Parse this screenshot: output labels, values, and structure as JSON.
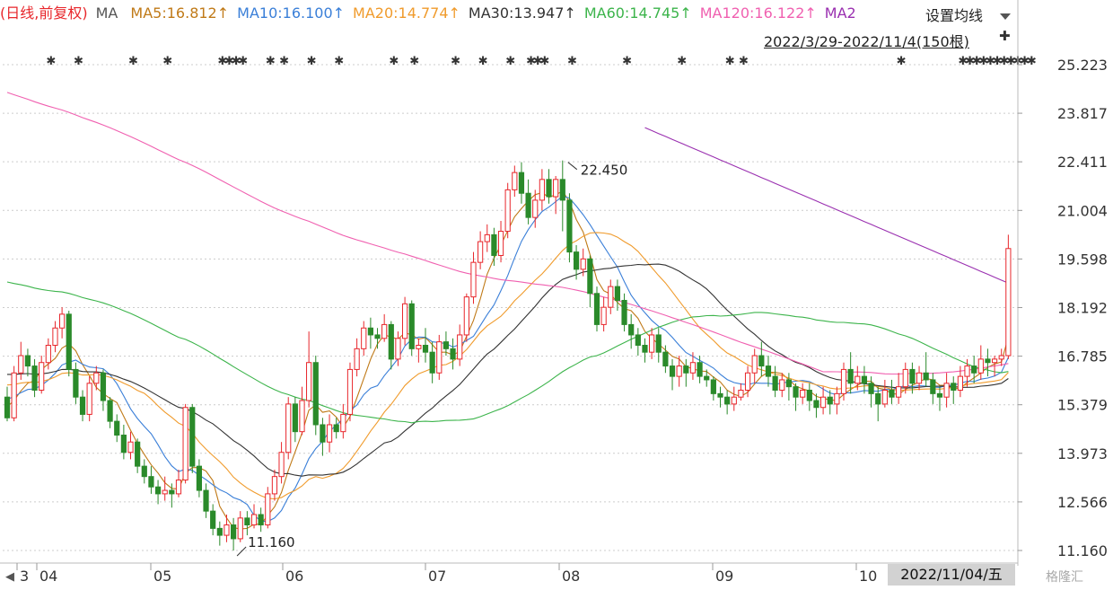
{
  "legend": {
    "prefix": "(日线,前复权)",
    "ma_label": "MA",
    "items": [
      {
        "text": "MA5:16.812↑",
        "color": "#c07a18"
      },
      {
        "text": "MA10:16.100↑",
        "color": "#3a7fd8"
      },
      {
        "text": "MA20:14.774↑",
        "color": "#f09b2c"
      },
      {
        "text": "MA30:13.947↑",
        "color": "#333333"
      },
      {
        "text": "MA60:14.745↑",
        "color": "#3cb44b"
      },
      {
        "text": "MA120:16.122↑",
        "color": "#f060b0"
      },
      {
        "text": "MA2",
        "color": "#9a30b0"
      }
    ]
  },
  "controls": {
    "set_ma": "设置均线",
    "date_range": "2022/3/29-2022/11/4(150根)",
    "cursor_date": "2022/11/04/五",
    "watermark": "格隆汇"
  },
  "chart_data": {
    "type": "candlestick",
    "y_ticks": [
      "25.223",
      "23.817",
      "22.411",
      "21.004",
      "19.598",
      "18.192",
      "16.785",
      "15.379",
      "13.973",
      "12.566",
      "11.160"
    ],
    "ylim": [
      11.16,
      25.223
    ],
    "x_labels": [
      "3",
      "04",
      "05",
      "06",
      "07",
      "08",
      "09",
      "10"
    ],
    "high_label": "22.450",
    "low_label": "11.160",
    "colors": {
      "up": "#e8262b",
      "down": "#2a8a2a",
      "grid": "#cccccc"
    },
    "candles": [
      [
        15.6,
        15.0,
        15.9,
        14.9
      ],
      [
        15.0,
        16.3,
        16.5,
        14.9
      ],
      [
        16.3,
        16.8,
        17.2,
        16.1
      ],
      [
        16.8,
        16.5,
        17.0,
        16.2
      ],
      [
        16.5,
        15.8,
        16.7,
        15.6
      ],
      [
        15.8,
        16.6,
        16.8,
        15.7
      ],
      [
        16.6,
        17.1,
        17.3,
        16.4
      ],
      [
        17.1,
        17.6,
        17.8,
        16.9
      ],
      [
        17.6,
        18.0,
        18.2,
        17.3
      ],
      [
        18.0,
        16.4,
        18.1,
        16.2
      ],
      [
        16.4,
        15.6,
        16.6,
        15.4
      ],
      [
        15.6,
        15.1,
        15.8,
        14.9
      ],
      [
        15.1,
        16.0,
        16.2,
        14.9
      ],
      [
        16.0,
        16.3,
        16.5,
        15.8
      ],
      [
        16.3,
        15.5,
        16.4,
        15.2
      ],
      [
        15.5,
        14.9,
        15.6,
        14.7
      ],
      [
        14.9,
        14.5,
        15.1,
        14.3
      ],
      [
        14.5,
        14.0,
        14.8,
        13.8
      ],
      [
        14.0,
        14.3,
        14.6,
        13.8
      ],
      [
        14.3,
        13.6,
        14.4,
        13.4
      ],
      [
        13.6,
        13.3,
        13.8,
        13.1
      ],
      [
        13.3,
        13.0,
        13.6,
        12.8
      ],
      [
        13.0,
        12.8,
        13.2,
        12.5
      ],
      [
        12.8,
        12.9,
        13.3,
        12.6
      ],
      [
        12.9,
        12.8,
        13.1,
        12.4
      ],
      [
        12.8,
        13.2,
        13.5,
        12.7
      ],
      [
        13.2,
        15.3,
        15.4,
        13.1
      ],
      [
        15.3,
        13.6,
        15.4,
        13.4
      ],
      [
        13.6,
        12.9,
        13.8,
        12.7
      ],
      [
        12.9,
        12.3,
        13.1,
        12.1
      ],
      [
        12.3,
        11.8,
        12.5,
        11.6
      ],
      [
        11.8,
        11.6,
        12.0,
        11.3
      ],
      [
        11.6,
        11.9,
        12.2,
        11.4
      ],
      [
        11.9,
        11.5,
        12.1,
        11.16
      ],
      [
        11.5,
        12.1,
        12.3,
        11.4
      ],
      [
        12.1,
        11.9,
        12.3,
        11.6
      ],
      [
        11.9,
        12.2,
        12.5,
        11.8
      ],
      [
        12.2,
        11.9,
        12.4,
        11.7
      ],
      [
        11.9,
        12.8,
        13.0,
        11.8
      ],
      [
        12.8,
        13.3,
        13.5,
        12.6
      ],
      [
        13.3,
        14.0,
        14.3,
        13.1
      ],
      [
        14.0,
        15.4,
        15.6,
        13.8
      ],
      [
        15.4,
        14.6,
        15.6,
        14.3
      ],
      [
        14.6,
        15.5,
        15.9,
        14.5
      ],
      [
        15.5,
        16.6,
        17.5,
        15.3
      ],
      [
        16.6,
        14.8,
        16.8,
        14.5
      ],
      [
        14.8,
        14.3,
        15.0,
        13.9
      ],
      [
        14.3,
        14.8,
        15.1,
        14.0
      ],
      [
        14.8,
        14.6,
        15.0,
        14.4
      ],
      [
        14.6,
        15.1,
        15.4,
        14.4
      ],
      [
        15.1,
        16.4,
        16.6,
        14.9
      ],
      [
        16.4,
        17.0,
        17.3,
        16.2
      ],
      [
        17.0,
        17.6,
        17.8,
        16.8
      ],
      [
        17.6,
        17.4,
        17.9,
        17.0
      ],
      [
        17.4,
        17.3,
        17.6,
        17.0
      ],
      [
        17.3,
        17.7,
        18.0,
        17.2
      ],
      [
        17.7,
        16.7,
        17.8,
        16.4
      ],
      [
        16.7,
        17.3,
        17.5,
        16.5
      ],
      [
        17.3,
        18.3,
        18.5,
        17.1
      ],
      [
        18.3,
        17.0,
        18.4,
        16.8
      ],
      [
        17.0,
        17.1,
        17.3,
        16.6
      ],
      [
        17.1,
        16.9,
        17.6,
        16.6
      ],
      [
        16.9,
        16.3,
        17.2,
        16.0
      ],
      [
        16.3,
        17.2,
        17.4,
        16.1
      ],
      [
        17.2,
        17.0,
        17.5,
        16.8
      ],
      [
        17.0,
        16.7,
        17.3,
        16.4
      ],
      [
        16.7,
        17.4,
        17.7,
        16.5
      ],
      [
        17.4,
        18.5,
        18.6,
        17.2
      ],
      [
        18.5,
        19.5,
        19.8,
        18.3
      ],
      [
        19.5,
        20.1,
        20.4,
        19.3
      ],
      [
        20.1,
        20.3,
        20.6,
        19.8
      ],
      [
        20.3,
        19.7,
        20.5,
        19.4
      ],
      [
        19.7,
        20.4,
        20.7,
        19.5
      ],
      [
        20.4,
        21.6,
        21.8,
        20.2
      ],
      [
        21.6,
        22.1,
        22.3,
        21.4
      ],
      [
        22.1,
        21.5,
        22.4,
        21.2
      ],
      [
        21.5,
        20.8,
        21.9,
        20.6
      ],
      [
        20.8,
        21.3,
        21.6,
        20.5
      ],
      [
        21.3,
        21.9,
        22.2,
        21.0
      ],
      [
        21.9,
        21.4,
        22.2,
        21.2
      ],
      [
        21.4,
        21.9,
        22.0,
        20.9
      ],
      [
        21.9,
        21.3,
        22.45,
        20.4
      ],
      [
        21.3,
        19.8,
        21.5,
        19.5
      ],
      [
        19.8,
        19.3,
        20.0,
        19.0
      ],
      [
        19.3,
        19.6,
        19.9,
        19.1
      ],
      [
        19.6,
        18.6,
        19.7,
        18.2
      ],
      [
        18.6,
        17.7,
        18.8,
        17.5
      ],
      [
        17.7,
        18.2,
        18.5,
        17.5
      ],
      [
        18.2,
        18.8,
        19.0,
        18.0
      ],
      [
        18.8,
        18.4,
        19.0,
        18.1
      ],
      [
        18.4,
        17.7,
        18.6,
        17.5
      ],
      [
        17.7,
        17.4,
        18.0,
        17.0
      ],
      [
        17.4,
        17.1,
        17.6,
        16.8
      ],
      [
        17.1,
        16.9,
        17.3,
        16.6
      ],
      [
        16.9,
        17.4,
        17.6,
        16.7
      ],
      [
        17.4,
        16.9,
        17.6,
        16.6
      ],
      [
        16.9,
        16.5,
        17.1,
        16.3
      ],
      [
        16.5,
        16.2,
        16.7,
        15.8
      ],
      [
        16.2,
        16.5,
        16.8,
        15.9
      ],
      [
        16.5,
        16.3,
        16.7,
        15.9
      ],
      [
        16.3,
        16.6,
        16.9,
        16.1
      ],
      [
        16.6,
        16.2,
        16.8,
        16.0
      ],
      [
        16.2,
        16.1,
        16.4,
        15.9
      ],
      [
        16.1,
        15.7,
        16.2,
        15.5
      ],
      [
        15.7,
        15.6,
        15.9,
        15.3
      ],
      [
        15.6,
        15.4,
        15.8,
        15.1
      ],
      [
        15.4,
        15.6,
        15.9,
        15.2
      ],
      [
        15.6,
        15.8,
        16.0,
        15.5
      ],
      [
        15.8,
        16.3,
        16.5,
        15.6
      ],
      [
        16.3,
        16.8,
        17.0,
        16.0
      ],
      [
        16.8,
        16.5,
        17.2,
        16.2
      ],
      [
        16.5,
        16.2,
        16.8,
        15.9
      ],
      [
        16.2,
        15.8,
        16.5,
        15.6
      ],
      [
        15.8,
        16.1,
        16.3,
        15.6
      ],
      [
        16.1,
        15.9,
        16.3,
        15.5
      ],
      [
        15.9,
        15.6,
        16.0,
        15.2
      ],
      [
        15.6,
        15.8,
        16.0,
        15.4
      ],
      [
        15.8,
        15.5,
        16.0,
        15.2
      ],
      [
        15.5,
        15.3,
        15.7,
        15.0
      ],
      [
        15.3,
        15.6,
        15.9,
        15.1
      ],
      [
        15.6,
        15.4,
        15.8,
        15.1
      ],
      [
        15.4,
        15.7,
        15.9,
        15.1
      ],
      [
        15.7,
        16.4,
        16.6,
        15.5
      ],
      [
        16.4,
        16.0,
        16.9,
        15.7
      ],
      [
        16.0,
        16.2,
        16.5,
        15.8
      ],
      [
        16.2,
        16.0,
        16.5,
        15.7
      ],
      [
        16.0,
        15.7,
        16.2,
        15.3
      ],
      [
        15.7,
        15.4,
        15.9,
        14.9
      ],
      [
        15.4,
        15.8,
        16.1,
        15.3
      ],
      [
        15.8,
        15.6,
        16.1,
        15.4
      ],
      [
        15.6,
        15.9,
        16.3,
        15.4
      ],
      [
        15.9,
        16.4,
        16.6,
        15.7
      ],
      [
        16.4,
        16.0,
        16.6,
        15.7
      ],
      [
        16.0,
        16.3,
        16.5,
        15.8
      ],
      [
        16.3,
        16.1,
        16.9,
        15.9
      ],
      [
        16.1,
        15.7,
        16.3,
        15.4
      ],
      [
        15.7,
        15.6,
        15.9,
        15.2
      ],
      [
        15.6,
        16.0,
        16.3,
        15.3
      ],
      [
        16.0,
        15.8,
        16.2,
        15.4
      ],
      [
        15.8,
        16.2,
        16.5,
        15.6
      ],
      [
        16.2,
        16.5,
        16.7,
        15.9
      ],
      [
        16.5,
        16.3,
        16.8,
        16.0
      ],
      [
        16.3,
        16.7,
        17.1,
        16.1
      ],
      [
        16.7,
        16.6,
        17.0,
        16.2
      ],
      [
        16.6,
        16.7,
        16.8,
        16.2
      ],
      [
        16.7,
        16.8,
        17.0,
        16.5
      ],
      [
        16.8,
        19.9,
        20.3,
        16.7
      ]
    ]
  }
}
